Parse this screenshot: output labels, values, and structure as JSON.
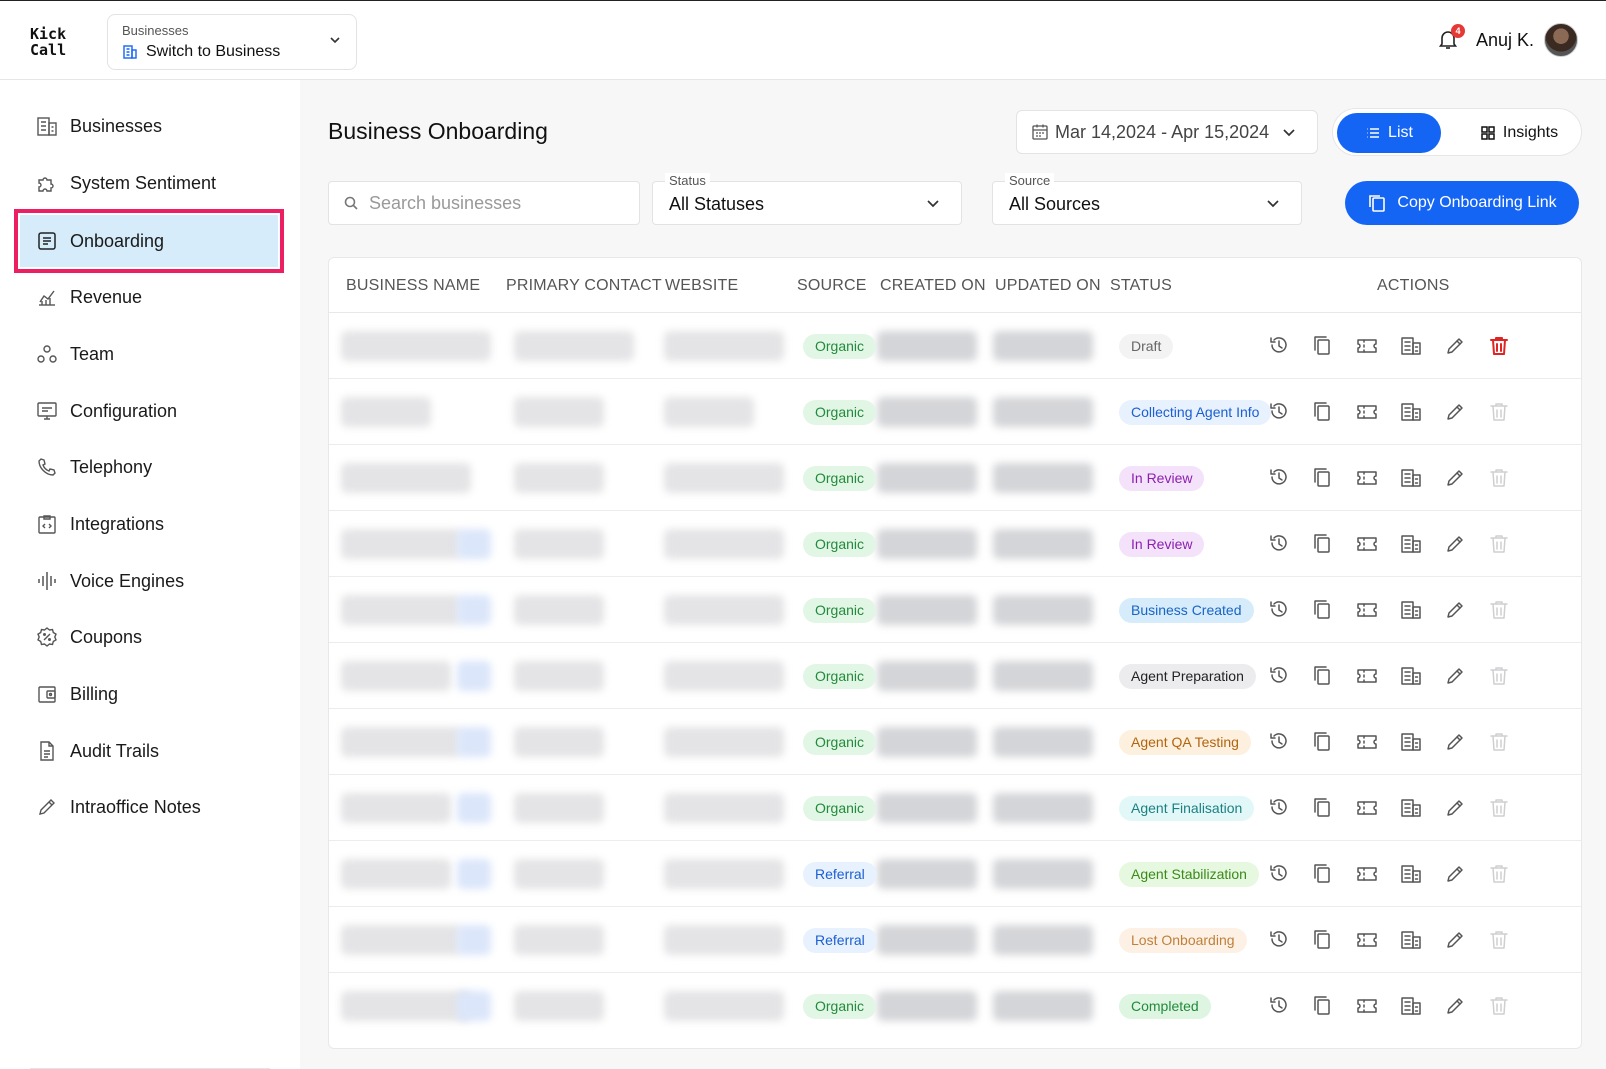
{
  "header": {
    "logo_line1": "Kick",
    "logo_line2": "Call",
    "business_switch_caption": "Businesses",
    "business_switch_value": "Switch to Business",
    "notification_count": "4",
    "user_name": "Anuj K."
  },
  "sidebar": {
    "items": [
      {
        "label": "Businesses",
        "icon": "building-icon"
      },
      {
        "label": "System Sentiment",
        "icon": "puzzle-icon"
      },
      {
        "label": "Onboarding",
        "icon": "document-icon",
        "active": true
      },
      {
        "label": "Revenue",
        "icon": "chart-icon"
      },
      {
        "label": "Team",
        "icon": "team-icon"
      },
      {
        "label": "Configuration",
        "icon": "monitor-settings-icon"
      },
      {
        "label": "Telephony",
        "icon": "phone-icon"
      },
      {
        "label": "Integrations",
        "icon": "code-clipboard-icon"
      },
      {
        "label": "Voice Engines",
        "icon": "waveform-icon"
      },
      {
        "label": "Coupons",
        "icon": "coupon-badge-icon"
      },
      {
        "label": "Billing",
        "icon": "wallet-icon"
      },
      {
        "label": "Audit Trails",
        "icon": "file-icon"
      },
      {
        "label": "Intraoffice Notes",
        "icon": "pencil-icon"
      }
    ]
  },
  "page": {
    "title": "Business Onboarding",
    "date_range": "Mar 14,2024 - Apr 15,2024",
    "view_list": "List",
    "view_insights": "Insights",
    "search_placeholder": "Search businesses",
    "status_label": "Status",
    "status_value": "All Statuses",
    "source_label": "Source",
    "source_value": "All Sources",
    "copy_link_label": "Copy Onboarding Link"
  },
  "table": {
    "columns": [
      "BUSINESS NAME",
      "PRIMARY CONTACT",
      "WEBSITE",
      "SOURCE",
      "CREATED ON",
      "UPDATED ON",
      "STATUS",
      "ACTIONS"
    ],
    "rows": [
      {
        "source": "Organic",
        "status": "Draft",
        "delete_enabled": true
      },
      {
        "source": "Organic",
        "status": "Collecting Agent Info",
        "delete_enabled": false
      },
      {
        "source": "Organic",
        "status": "In Review",
        "delete_enabled": false
      },
      {
        "source": "Organic",
        "status": "In Review",
        "delete_enabled": false
      },
      {
        "source": "Organic",
        "status": "Business Created",
        "delete_enabled": false
      },
      {
        "source": "Organic",
        "status": "Agent Preparation",
        "delete_enabled": false
      },
      {
        "source": "Organic",
        "status": "Agent QA Testing",
        "delete_enabled": false
      },
      {
        "source": "Organic",
        "status": "Agent Finalisation",
        "delete_enabled": false
      },
      {
        "source": "Referral",
        "status": "Agent Stabilization",
        "delete_enabled": false
      },
      {
        "source": "Referral",
        "status": "Lost Onboarding",
        "delete_enabled": false
      },
      {
        "source": "Organic",
        "status": "Completed",
        "delete_enabled": false
      }
    ]
  },
  "colors": {
    "primary": "#1565f5",
    "highlight_outline": "#ec1f63",
    "active_bg": "#d6ecfb",
    "delete_red": "#e02424"
  }
}
